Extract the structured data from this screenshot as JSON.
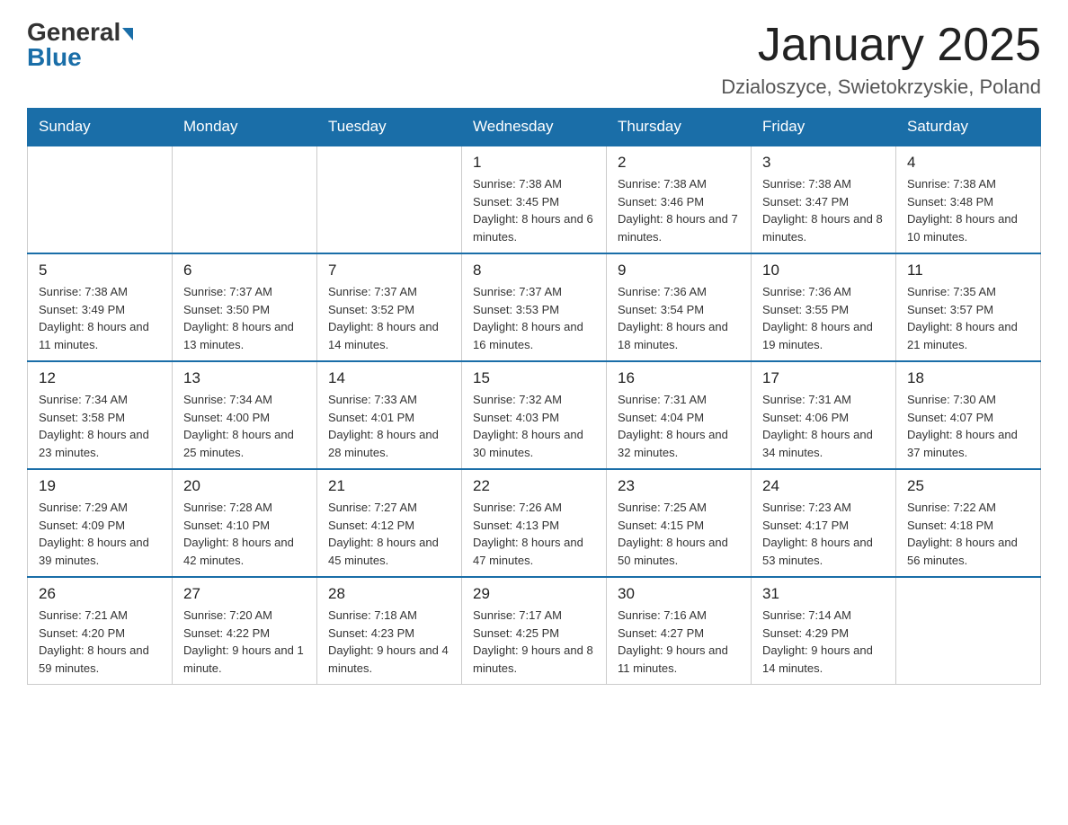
{
  "header": {
    "logo_general": "General",
    "logo_blue": "Blue",
    "title": "January 2025",
    "subtitle": "Dzialoszyce, Swietokrzyskie, Poland"
  },
  "days_of_week": [
    "Sunday",
    "Monday",
    "Tuesday",
    "Wednesday",
    "Thursday",
    "Friday",
    "Saturday"
  ],
  "weeks": [
    [
      {
        "day": "",
        "info": ""
      },
      {
        "day": "",
        "info": ""
      },
      {
        "day": "",
        "info": ""
      },
      {
        "day": "1",
        "info": "Sunrise: 7:38 AM\nSunset: 3:45 PM\nDaylight: 8 hours and 6 minutes."
      },
      {
        "day": "2",
        "info": "Sunrise: 7:38 AM\nSunset: 3:46 PM\nDaylight: 8 hours and 7 minutes."
      },
      {
        "day": "3",
        "info": "Sunrise: 7:38 AM\nSunset: 3:47 PM\nDaylight: 8 hours and 8 minutes."
      },
      {
        "day": "4",
        "info": "Sunrise: 7:38 AM\nSunset: 3:48 PM\nDaylight: 8 hours and 10 minutes."
      }
    ],
    [
      {
        "day": "5",
        "info": "Sunrise: 7:38 AM\nSunset: 3:49 PM\nDaylight: 8 hours and 11 minutes."
      },
      {
        "day": "6",
        "info": "Sunrise: 7:37 AM\nSunset: 3:50 PM\nDaylight: 8 hours and 13 minutes."
      },
      {
        "day": "7",
        "info": "Sunrise: 7:37 AM\nSunset: 3:52 PM\nDaylight: 8 hours and 14 minutes."
      },
      {
        "day": "8",
        "info": "Sunrise: 7:37 AM\nSunset: 3:53 PM\nDaylight: 8 hours and 16 minutes."
      },
      {
        "day": "9",
        "info": "Sunrise: 7:36 AM\nSunset: 3:54 PM\nDaylight: 8 hours and 18 minutes."
      },
      {
        "day": "10",
        "info": "Sunrise: 7:36 AM\nSunset: 3:55 PM\nDaylight: 8 hours and 19 minutes."
      },
      {
        "day": "11",
        "info": "Sunrise: 7:35 AM\nSunset: 3:57 PM\nDaylight: 8 hours and 21 minutes."
      }
    ],
    [
      {
        "day": "12",
        "info": "Sunrise: 7:34 AM\nSunset: 3:58 PM\nDaylight: 8 hours and 23 minutes."
      },
      {
        "day": "13",
        "info": "Sunrise: 7:34 AM\nSunset: 4:00 PM\nDaylight: 8 hours and 25 minutes."
      },
      {
        "day": "14",
        "info": "Sunrise: 7:33 AM\nSunset: 4:01 PM\nDaylight: 8 hours and 28 minutes."
      },
      {
        "day": "15",
        "info": "Sunrise: 7:32 AM\nSunset: 4:03 PM\nDaylight: 8 hours and 30 minutes."
      },
      {
        "day": "16",
        "info": "Sunrise: 7:31 AM\nSunset: 4:04 PM\nDaylight: 8 hours and 32 minutes."
      },
      {
        "day": "17",
        "info": "Sunrise: 7:31 AM\nSunset: 4:06 PM\nDaylight: 8 hours and 34 minutes."
      },
      {
        "day": "18",
        "info": "Sunrise: 7:30 AM\nSunset: 4:07 PM\nDaylight: 8 hours and 37 minutes."
      }
    ],
    [
      {
        "day": "19",
        "info": "Sunrise: 7:29 AM\nSunset: 4:09 PM\nDaylight: 8 hours and 39 minutes."
      },
      {
        "day": "20",
        "info": "Sunrise: 7:28 AM\nSunset: 4:10 PM\nDaylight: 8 hours and 42 minutes."
      },
      {
        "day": "21",
        "info": "Sunrise: 7:27 AM\nSunset: 4:12 PM\nDaylight: 8 hours and 45 minutes."
      },
      {
        "day": "22",
        "info": "Sunrise: 7:26 AM\nSunset: 4:13 PM\nDaylight: 8 hours and 47 minutes."
      },
      {
        "day": "23",
        "info": "Sunrise: 7:25 AM\nSunset: 4:15 PM\nDaylight: 8 hours and 50 minutes."
      },
      {
        "day": "24",
        "info": "Sunrise: 7:23 AM\nSunset: 4:17 PM\nDaylight: 8 hours and 53 minutes."
      },
      {
        "day": "25",
        "info": "Sunrise: 7:22 AM\nSunset: 4:18 PM\nDaylight: 8 hours and 56 minutes."
      }
    ],
    [
      {
        "day": "26",
        "info": "Sunrise: 7:21 AM\nSunset: 4:20 PM\nDaylight: 8 hours and 59 minutes."
      },
      {
        "day": "27",
        "info": "Sunrise: 7:20 AM\nSunset: 4:22 PM\nDaylight: 9 hours and 1 minute."
      },
      {
        "day": "28",
        "info": "Sunrise: 7:18 AM\nSunset: 4:23 PM\nDaylight: 9 hours and 4 minutes."
      },
      {
        "day": "29",
        "info": "Sunrise: 7:17 AM\nSunset: 4:25 PM\nDaylight: 9 hours and 8 minutes."
      },
      {
        "day": "30",
        "info": "Sunrise: 7:16 AM\nSunset: 4:27 PM\nDaylight: 9 hours and 11 minutes."
      },
      {
        "day": "31",
        "info": "Sunrise: 7:14 AM\nSunset: 4:29 PM\nDaylight: 9 hours and 14 minutes."
      },
      {
        "day": "",
        "info": ""
      }
    ]
  ]
}
